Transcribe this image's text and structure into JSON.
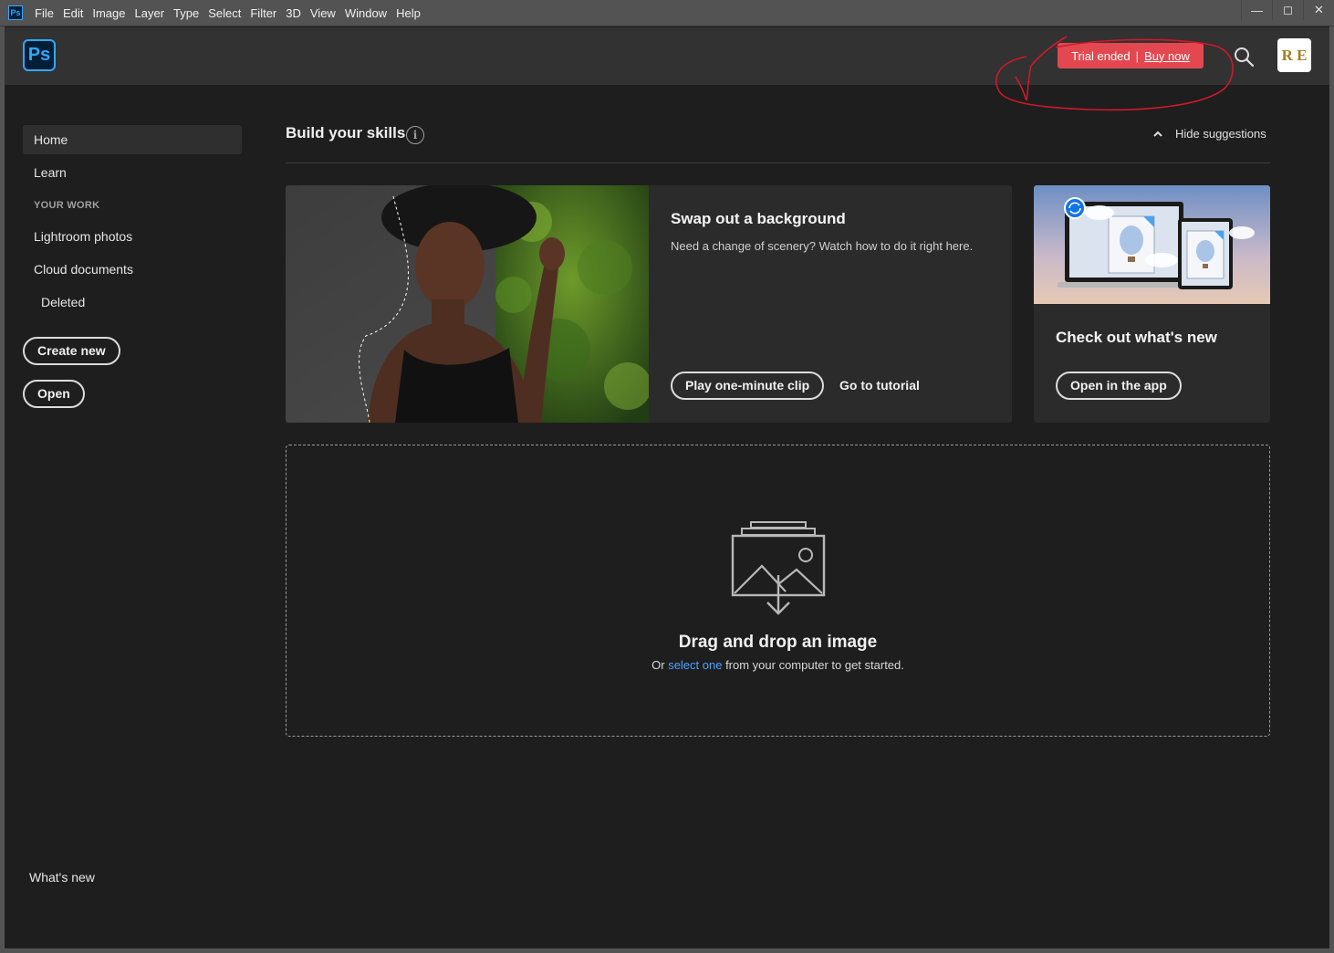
{
  "app_icon_text": "Ps",
  "menu": [
    "File",
    "Edit",
    "Image",
    "Layer",
    "Type",
    "Select",
    "Filter",
    "3D",
    "View",
    "Window",
    "Help"
  ],
  "window_controls": {
    "minimize": "—",
    "maximize": "◻",
    "close": "✕"
  },
  "header": {
    "logo_text": "Ps",
    "trial_label": "Trial ended",
    "separator": "|",
    "buy_label": "Buy now",
    "avatar_text": "R E"
  },
  "sidebar": {
    "home": "Home",
    "learn": "Learn",
    "section_heading": "YOUR WORK",
    "lightroom": "Lightroom photos",
    "cloud_docs": "Cloud documents",
    "deleted": "Deleted",
    "create_new": "Create new",
    "open": "Open",
    "whats_new": "What's new"
  },
  "skills": {
    "title": "Build your skills",
    "info_glyph": "i",
    "hide_label": "Hide suggestions"
  },
  "card_background": {
    "title": "Swap out a background",
    "description": "Need a change of scenery? Watch how to do it right here.",
    "play_label": "Play one-minute clip",
    "tutorial_label": "Go to tutorial"
  },
  "card_whats_new": {
    "title": "Check out what's new",
    "button_label": "Open in the app"
  },
  "dropzone": {
    "title": "Drag and drop an image",
    "sub_prefix": "Or ",
    "sub_link": "select one",
    "sub_suffix": " from your computer to get started."
  },
  "colors": {
    "accent_red": "#e34850",
    "ps_blue": "#31a8ff",
    "link_blue": "#4ba3ff"
  }
}
